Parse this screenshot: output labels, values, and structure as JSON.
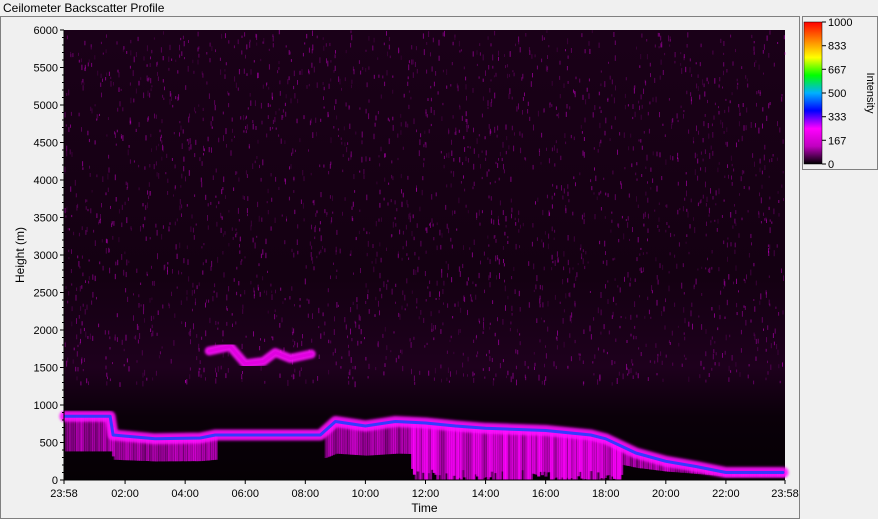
{
  "window": {
    "title": "Ceilometer Backscatter Profile"
  },
  "chart_data": {
    "type": "heatmap",
    "title": "Ceilometer Backscatter Profile",
    "xlabel": "Time",
    "ylabel": "Height (m)",
    "x_ticks": [
      "23:58",
      "02:00",
      "04:00",
      "06:00",
      "08:00",
      "10:00",
      "12:00",
      "14:00",
      "16:00",
      "18:00",
      "20:00",
      "22:00",
      "23:58"
    ],
    "y_ticks": [
      0,
      500,
      1000,
      1500,
      2000,
      2500,
      3000,
      3500,
      4000,
      4500,
      5000,
      5500,
      6000
    ],
    "ylim": [
      0,
      6000
    ],
    "xlim_hours": [
      -0.033,
      23.967
    ],
    "colorbar": {
      "label": "Intensity",
      "ticks": [
        1000,
        833,
        667,
        500,
        333,
        167,
        0
      ],
      "colors": [
        "#000000",
        "#c000c0",
        "#ff00ff",
        "#0000ff",
        "#00b0ff",
        "#00ff00",
        "#ffff00",
        "#ff8000",
        "#ff0000"
      ]
    },
    "layers": [
      {
        "name": "boundary-layer",
        "points": [
          [
            0,
            850
          ],
          [
            1.5,
            850
          ],
          [
            1.6,
            600
          ],
          [
            3,
            550
          ],
          [
            4.5,
            560
          ],
          [
            5,
            600
          ],
          [
            8.5,
            600
          ],
          [
            9,
            780
          ],
          [
            10,
            720
          ],
          [
            11,
            780
          ],
          [
            12,
            760
          ],
          [
            13,
            720
          ],
          [
            14,
            690
          ],
          [
            16,
            660
          ],
          [
            17.5,
            600
          ],
          [
            18,
            550
          ],
          [
            19,
            360
          ],
          [
            20,
            250
          ],
          [
            21,
            180
          ],
          [
            22,
            100
          ],
          [
            23.9,
            100
          ]
        ]
      },
      {
        "name": "elevated-layer",
        "points": [
          [
            4.8,
            1720
          ],
          [
            5.5,
            1780
          ],
          [
            6,
            1550
          ],
          [
            6.6,
            1580
          ],
          [
            7,
            1700
          ],
          [
            7.5,
            1620
          ],
          [
            8.2,
            1680
          ]
        ]
      }
    ]
  }
}
